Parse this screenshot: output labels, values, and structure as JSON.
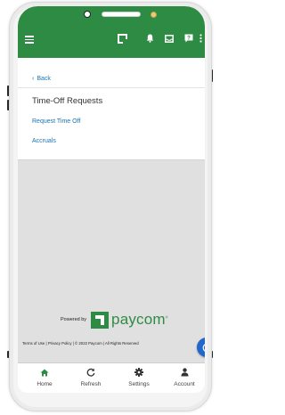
{
  "header": {
    "background_color": "#2e8b43",
    "icons": [
      "menu-icon",
      "paycom-logo-icon",
      "bell-icon",
      "inbox-icon",
      "help-icon",
      "more-vertical-icon"
    ]
  },
  "nav": {
    "back_label": "Back"
  },
  "page": {
    "title": "Time-Off Requests",
    "links": [
      {
        "label": "Request Time Off"
      },
      {
        "label": "Accruals"
      }
    ]
  },
  "branding": {
    "powered_by": "Powered by",
    "brand_name": "paycom",
    "brand_color": "#2e8b43"
  },
  "footer": {
    "terms_text": "Terms of Use | Privacy Policy | © 2022 Paycom | All Rights Reserved"
  },
  "tabs": [
    {
      "label": "Home",
      "icon": "home-icon"
    },
    {
      "label": "Refresh",
      "icon": "refresh-icon"
    },
    {
      "label": "Settings",
      "icon": "gear-icon"
    },
    {
      "label": "Account",
      "icon": "person-icon"
    }
  ],
  "fab": {
    "icon": "clock-icon",
    "color": "#2267c9"
  },
  "link_color": "#1a73b5"
}
